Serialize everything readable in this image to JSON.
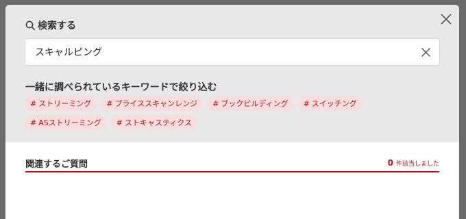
{
  "search": {
    "heading": "検索する",
    "query": "スキャルピング"
  },
  "keywords": {
    "heading": "一緒に調べられているキーワードで絞り込む",
    "hash": "#",
    "items": [
      "ストリーミング",
      "プライススキャンレンジ",
      "ブックビルディング",
      "スイッチング",
      "ASストリーミング",
      "ストキャスティクス"
    ]
  },
  "faq": {
    "title": "関連するご質問",
    "count": "0",
    "count_suffix": "件該当しました"
  },
  "icons": {
    "search": "search-icon",
    "close": "close-icon",
    "clear": "clear-icon"
  },
  "colors": {
    "accent": "#b5141b",
    "chip_bg": "#f6dede",
    "panel_bg": "#e8e8e8",
    "backdrop": "#6b6b6b"
  }
}
